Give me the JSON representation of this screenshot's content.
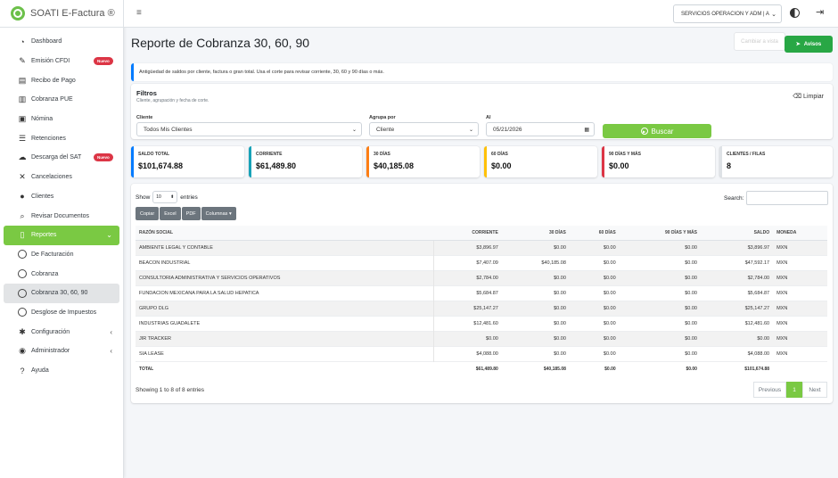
{
  "app": {
    "name": "SOATI E-Factura ®"
  },
  "sidebar": {
    "items": [
      {
        "label": "Dashboard",
        "icon": "dashboard-icon"
      },
      {
        "label": "Emisión CFDI",
        "icon": "edit-icon",
        "badge": "Nuevo"
      },
      {
        "label": "Recibo de Pago",
        "icon": "receipt-icon"
      },
      {
        "label": "Cobranza PUE",
        "icon": "file-invoice-icon"
      },
      {
        "label": "Nómina",
        "icon": "payroll-icon"
      },
      {
        "label": "Retenciones",
        "icon": "list-icon"
      },
      {
        "label": "Descarga del SAT",
        "icon": "cloud-download-icon",
        "badge": "Nuevo"
      },
      {
        "label": "Cancelaciones",
        "icon": "close-icon"
      },
      {
        "label": "Clientes",
        "icon": "user-icon"
      },
      {
        "label": "Revisar Documentos",
        "icon": "search-icon"
      },
      {
        "label": "Reportes",
        "icon": "report-icon"
      },
      {
        "label": "De Facturación",
        "icon": "circle-icon"
      },
      {
        "label": "Cobranza",
        "icon": "circle-icon"
      },
      {
        "label": "Cobranza 30, 60, 90",
        "icon": "circle-icon"
      },
      {
        "label": "Desglose de Impuestos",
        "icon": "circle-icon"
      },
      {
        "label": "Configuración",
        "icon": "tools-icon"
      },
      {
        "label": "Administrador",
        "icon": "admin-icon"
      },
      {
        "label": "Ayuda",
        "icon": "help-icon"
      }
    ]
  },
  "header": {
    "company": "SERVICIOS OPERACION Y ADM | A"
  },
  "page": {
    "title": "Reporte de Cobranza 30, 60, 90",
    "ghost_button": "Cambiar a vista",
    "avisos": "Avisos",
    "info": "Antigüedad de saldos por cliente, factura o gran total. Usa el corte para revisar corriente, 30, 60 y 90 días o más."
  },
  "filters": {
    "title": "Filtros",
    "subtitle": "Cliente, agrupación y fecha de corte.",
    "clear": "Limpiar",
    "cliente_label": "Cliente",
    "cliente_value": "Todos Mis Clientes",
    "agrupa_label": "Agrupa por",
    "agrupa_value": "Cliente",
    "al_label": "Al",
    "al_value": "05/21/2026",
    "buscar": "Buscar"
  },
  "stats": [
    {
      "label": "SALDO TOTAL",
      "value": "$101,674.88",
      "color": "#007bff"
    },
    {
      "label": "CORRIENTE",
      "value": "$61,489.80",
      "color": "#17a2b8"
    },
    {
      "label": "30 DÍAS",
      "value": "$40,185.08",
      "color": "#fd7e14"
    },
    {
      "label": "60 DÍAS",
      "value": "$0.00",
      "color": "#ffc107"
    },
    {
      "label": "90 DÍAS Y MÁS",
      "value": "$0.00",
      "color": "#dc3545"
    },
    {
      "label": "CLIENTES / FILAS",
      "value": "8",
      "color": "#dee2e6"
    }
  ],
  "table": {
    "show": "Show",
    "entries_value": "10",
    "entries": "entries",
    "search": "Search:",
    "buttons": [
      "Copiar",
      "Excel",
      "PDF",
      "Columnas ▾"
    ],
    "headers": [
      "RAZÓN SOCIAL",
      "CORRIENTE",
      "30 DÍAS",
      "60 DÍAS",
      "90 DÍAS Y MÁS",
      "SALDO",
      "MONEDA"
    ],
    "rows": [
      [
        "AMBIENTE LEGAL Y CONTABLE",
        "$3,896.97",
        "$0.00",
        "$0.00",
        "$0.00",
        "$3,896.97",
        "MXN"
      ],
      [
        "BEACON INDUSTRIAL",
        "$7,407.09",
        "$40,185.08",
        "$0.00",
        "$0.00",
        "$47,592.17",
        "MXN"
      ],
      [
        "CONSULTORIA ADMINISTRATIVA Y SERVICIOS OPERATIVOS",
        "$2,784.00",
        "$0.00",
        "$0.00",
        "$0.00",
        "$2,784.00",
        "MXN"
      ],
      [
        "FUNDACION MEXICANA PARA LA SALUD HEPATICA",
        "$5,684.87",
        "$0.00",
        "$0.00",
        "$0.00",
        "$5,684.87",
        "MXN"
      ],
      [
        "GRUPO DLG",
        "$25,147.27",
        "$0.00",
        "$0.00",
        "$0.00",
        "$25,147.27",
        "MXN"
      ],
      [
        "INDUSTRIAS GUADALETE",
        "$12,481.60",
        "$0.00",
        "$0.00",
        "$0.00",
        "$12,481.60",
        "MXN"
      ],
      [
        "JIR TRACKER",
        "$0.00",
        "$0.00",
        "$0.00",
        "$0.00",
        "$0.00",
        "MXN"
      ],
      [
        "SIA LEASE",
        "$4,088.00",
        "$0.00",
        "$0.00",
        "$0.00",
        "$4,088.00",
        "MXN"
      ]
    ],
    "total": [
      "TOTAL",
      "$61,489.80",
      "$40,185.08",
      "$0.00",
      "$0.00",
      "$101,674.88",
      ""
    ],
    "showing": "Showing 1 to 8 of 8 entries",
    "prev": "Previous",
    "page": "1",
    "next": "Next"
  }
}
